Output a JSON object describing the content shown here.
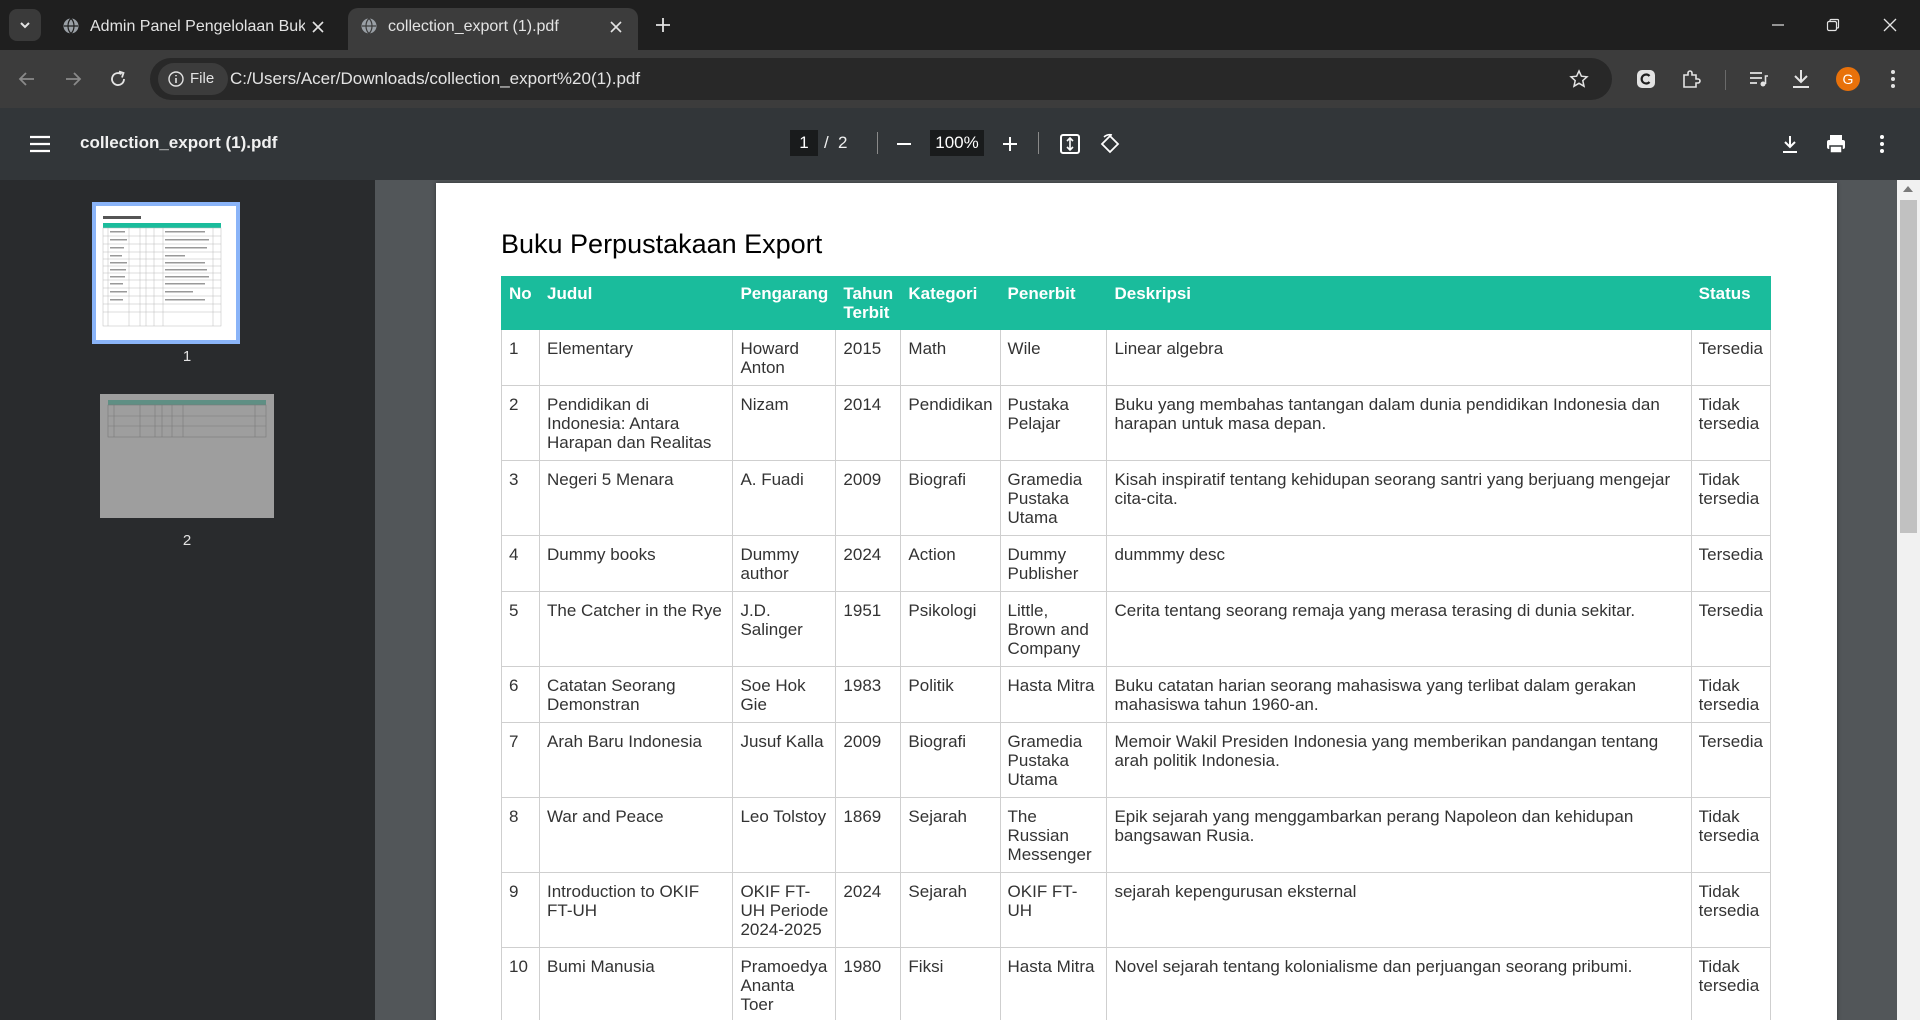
{
  "browser": {
    "tabs": [
      {
        "title": "Admin Panel Pengelolaan Buku"
      },
      {
        "title": "collection_export (1).pdf",
        "active": true
      }
    ],
    "omnibox": {
      "chip_label": "File",
      "url": "C:/Users/Acer/Downloads/collection_export%20(1).pdf"
    },
    "profile_initial": "G"
  },
  "pdf_toolbar": {
    "title": "collection_export (1).pdf",
    "current_page": "1",
    "separator": "/",
    "total_pages": "2",
    "zoom": "100%"
  },
  "sidebar": {
    "thumbnails": [
      {
        "label": "1"
      },
      {
        "label": "2"
      }
    ]
  },
  "document": {
    "title": "Buku Perpustakaan Export",
    "columns": [
      "No",
      "Judul",
      "Pengarang",
      "Tahun Terbit",
      "Kategori",
      "Penerbit",
      "Deskripsi",
      "Status"
    ],
    "rows": [
      [
        "1",
        "Elementary",
        "Howard Anton",
        "2015",
        "Math",
        "Wile",
        "Linear algebra",
        "Tersedia"
      ],
      [
        "2",
        "Pendidikan di Indonesia: Antara Harapan dan Realitas",
        "Nizam",
        "2014",
        "Pendidikan",
        "Pustaka Pelajar",
        "Buku yang membahas tantangan dalam dunia pendidikan Indonesia dan harapan untuk masa depan.",
        "Tidak tersedia"
      ],
      [
        "3",
        "Negeri 5 Menara",
        "A. Fuadi",
        "2009",
        "Biografi",
        "Gramedia Pustaka Utama",
        "Kisah inspiratif tentang kehidupan seorang santri yang berjuang mengejar cita-cita.",
        "Tidak tersedia"
      ],
      [
        "4",
        "Dummy books",
        "Dummy author",
        "2024",
        "Action",
        "Dummy Publisher",
        "dummmy desc",
        "Tersedia"
      ],
      [
        "5",
        "The Catcher in the Rye",
        "J.D. Salinger",
        "1951",
        "Psikologi",
        "Little, Brown and Company",
        "Cerita tentang seorang remaja yang merasa terasing di dunia sekitar.",
        "Tersedia"
      ],
      [
        "6",
        "Catatan Seorang Demonstran",
        "Soe Hok Gie",
        "1983",
        "Politik",
        "Hasta Mitra",
        "Buku catatan harian seorang mahasiswa yang terlibat dalam gerakan mahasiswa tahun 1960-an.",
        "Tidak tersedia"
      ],
      [
        "7",
        "Arah Baru Indonesia",
        "Jusuf Kalla",
        "2009",
        "Biografi",
        "Gramedia Pustaka Utama",
        "Memoir Wakil Presiden Indonesia yang memberikan pandangan tentang arah politik Indonesia.",
        "Tersedia"
      ],
      [
        "8",
        "War and Peace",
        "Leo Tolstoy",
        "1869",
        "Sejarah",
        "The Russian Messenger",
        "Epik sejarah yang menggambarkan perang Napoleon dan kehidupan bangsawan Rusia.",
        "Tidak tersedia"
      ],
      [
        "9",
        "Introduction to OKIF FT-UH",
        "OKIF FT-UH Periode 2024-2025",
        "2024",
        "Sejarah",
        "OKIF FT-UH",
        "sejarah kepengurusan eksternal",
        "Tidak tersedia"
      ],
      [
        "10",
        "Bumi Manusia",
        "Pramoedya Ananta Toer",
        "1980",
        "Fiksi",
        "Hasta Mitra",
        "Novel sejarah tentang kolonialisme dan perjuangan seorang pribumi.",
        "Tidak tersedia"
      ]
    ]
  },
  "colors": {
    "table_header": "#1abc9c",
    "thumbnail_selected": "#8ab4f8",
    "avatar": "#e8710a"
  }
}
